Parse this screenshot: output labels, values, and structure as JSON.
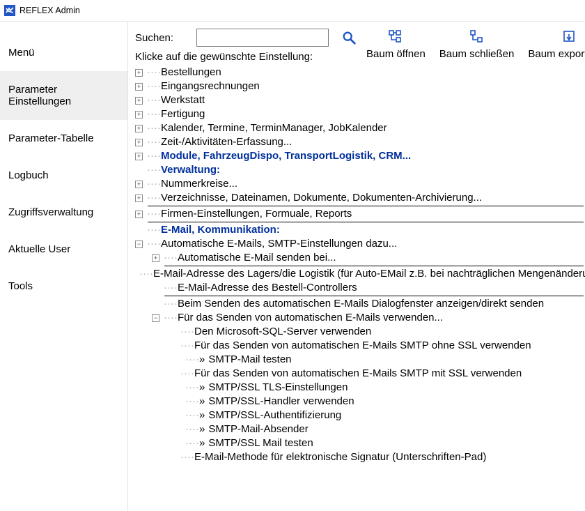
{
  "title": "REFLEX Admin",
  "sidebar": {
    "items": [
      "Menü",
      "Parameter Einstellungen",
      "Parameter-Tabelle",
      "Logbuch",
      "Zugriffsverwaltung",
      "Aktuelle User",
      "Tools"
    ],
    "selected_index": 1
  },
  "search": {
    "label": "Suchen:",
    "value": "",
    "hint": "Klicke auf die gewünschte Einstellung:"
  },
  "toolbar": {
    "open": "Baum öffnen",
    "close": "Baum schließen",
    "export": "Baum exportieren"
  },
  "tree": {
    "n0": "Bestellungen",
    "n1": "Eingangsrechnungen",
    "n2": "Werkstatt",
    "n3": "Fertigung",
    "n4": "Kalender, Termine, TerminManager, JobKalender",
    "n5": "Zeit-/Aktivitäten-Erfassung...",
    "n6": "Module, FahrzeugDispo, TransportLogistik, CRM...",
    "n7": "Verwaltung:",
    "n8": "Nummerkreise...",
    "n9": "Verzeichnisse, Dateinamen, Dokumente, Dokumenten-Archivierung...",
    "n10": "Firmen-Einstellungen, Formuale, Reports",
    "n11": "E-Mail, Kommunikation:",
    "n12": "Automatische E-Mails, SMTP-Einstellungen dazu...",
    "n13": "Automatische E-Mail senden bei...",
    "n14": "E-Mail-Adresse des Lagers/die Logistik (für Auto-EMail z.B. bei nachträglichen Mengenänderungen)",
    "n15": "E-Mail-Adresse des Bestell-Controllers",
    "n16": "Beim Senden des automatischen E-Mails Dialogfenster anzeigen/direkt senden",
    "n17": "Für das Senden von automatischen E-Mails verwenden...",
    "n18": "Den Microsoft-SQL-Server verwenden",
    "n19": "Für das Senden von automatischen E-Mails SMTP ohne SSL verwenden",
    "n20": "SMTP-Mail testen",
    "n21": "Für das Senden von automatischen E-Mails SMTP mit SSL verwenden",
    "n22": "SMTP/SSL TLS-Einstellungen",
    "n23": "SMTP/SSL-Handler verwenden",
    "n24": "SMTP/SSL-Authentifizierung",
    "n25": "SMTP-Mail-Absender",
    "n26": "SMTP/SSL Mail testen",
    "n27": "E-Mail-Methode für elektronische Signatur (Unterschriften-Pad)"
  }
}
